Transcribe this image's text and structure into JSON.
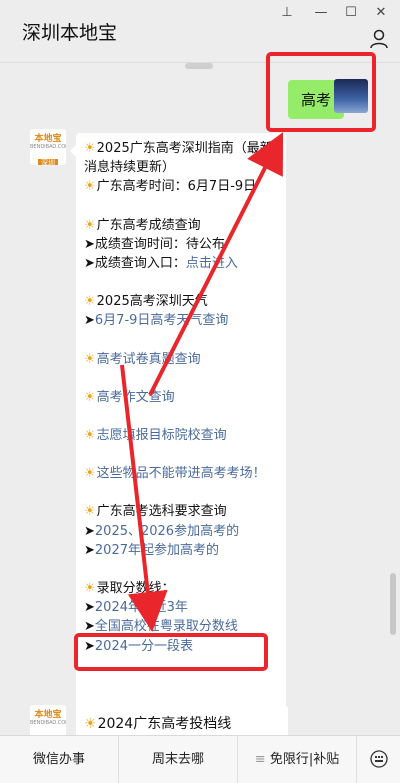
{
  "window": {
    "title": "深圳本地宝",
    "controls": {
      "pin": "⊥",
      "minimize": "—",
      "maximize": "☐",
      "close": "✕"
    }
  },
  "chat": {
    "user_message": "高考",
    "bot_lines": [
      {
        "kind": "sun",
        "text": "2025广东高考深圳指南（最新消息持续更新）"
      },
      {
        "kind": "sun",
        "text": "广东高考时间：6月7日-9日"
      },
      {
        "kind": "gap"
      },
      {
        "kind": "sun",
        "text": "广东高考成绩查询"
      },
      {
        "kind": "arrow",
        "text": "成绩查询时间：待公布"
      },
      {
        "kind": "arrow",
        "text": "成绩查询入口：",
        "link": "点击进入"
      },
      {
        "kind": "gap"
      },
      {
        "kind": "sun",
        "text": "2025高考深圳天气"
      },
      {
        "kind": "arrow",
        "link": "6月7-9日高考天气查询"
      },
      {
        "kind": "gap"
      },
      {
        "kind": "sun",
        "link": "高考试卷真题查询"
      },
      {
        "kind": "gap"
      },
      {
        "kind": "sun",
        "link": "高考作文查询"
      },
      {
        "kind": "gap"
      },
      {
        "kind": "sun",
        "link": "志愿填报目标院校查询"
      },
      {
        "kind": "gap"
      },
      {
        "kind": "sun",
        "link": "这些物品不能带进高考考场！"
      },
      {
        "kind": "gap"
      },
      {
        "kind": "sun",
        "text": "广东高考选科要求查询"
      },
      {
        "kind": "arrow",
        "link": "2025、2026参加高考的"
      },
      {
        "kind": "arrow",
        "link": "2027年起参加高考的"
      },
      {
        "kind": "gap"
      },
      {
        "kind": "sun",
        "text": "录取分数线："
      },
      {
        "kind": "arrow",
        "link": "2024年 | 近3年"
      },
      {
        "kind": "arrow",
        "link": "全国高校在粤录取分数线"
      },
      {
        "kind": "arrow",
        "link": "2024一分一段表"
      }
    ],
    "next_message": "2024广东高考投档线"
  },
  "bot_avatar": {
    "line1": "本地宝",
    "line2": "BENDIBAO.COM",
    "line3": "深圳"
  },
  "bottom_menu": {
    "items": [
      "微信办事",
      "周末去哪",
      "免限行|补贴"
    ],
    "menu_prefix": "≡"
  },
  "colors": {
    "accent_red": "#e8262b",
    "link": "#4a6a9c",
    "bubble_green": "#95ec69",
    "sun": "#f0a117"
  },
  "icons": [
    "pin-icon",
    "minimize-icon",
    "maximize-icon",
    "close-icon",
    "user-icon",
    "sun-icon",
    "keyboard-icon"
  ]
}
